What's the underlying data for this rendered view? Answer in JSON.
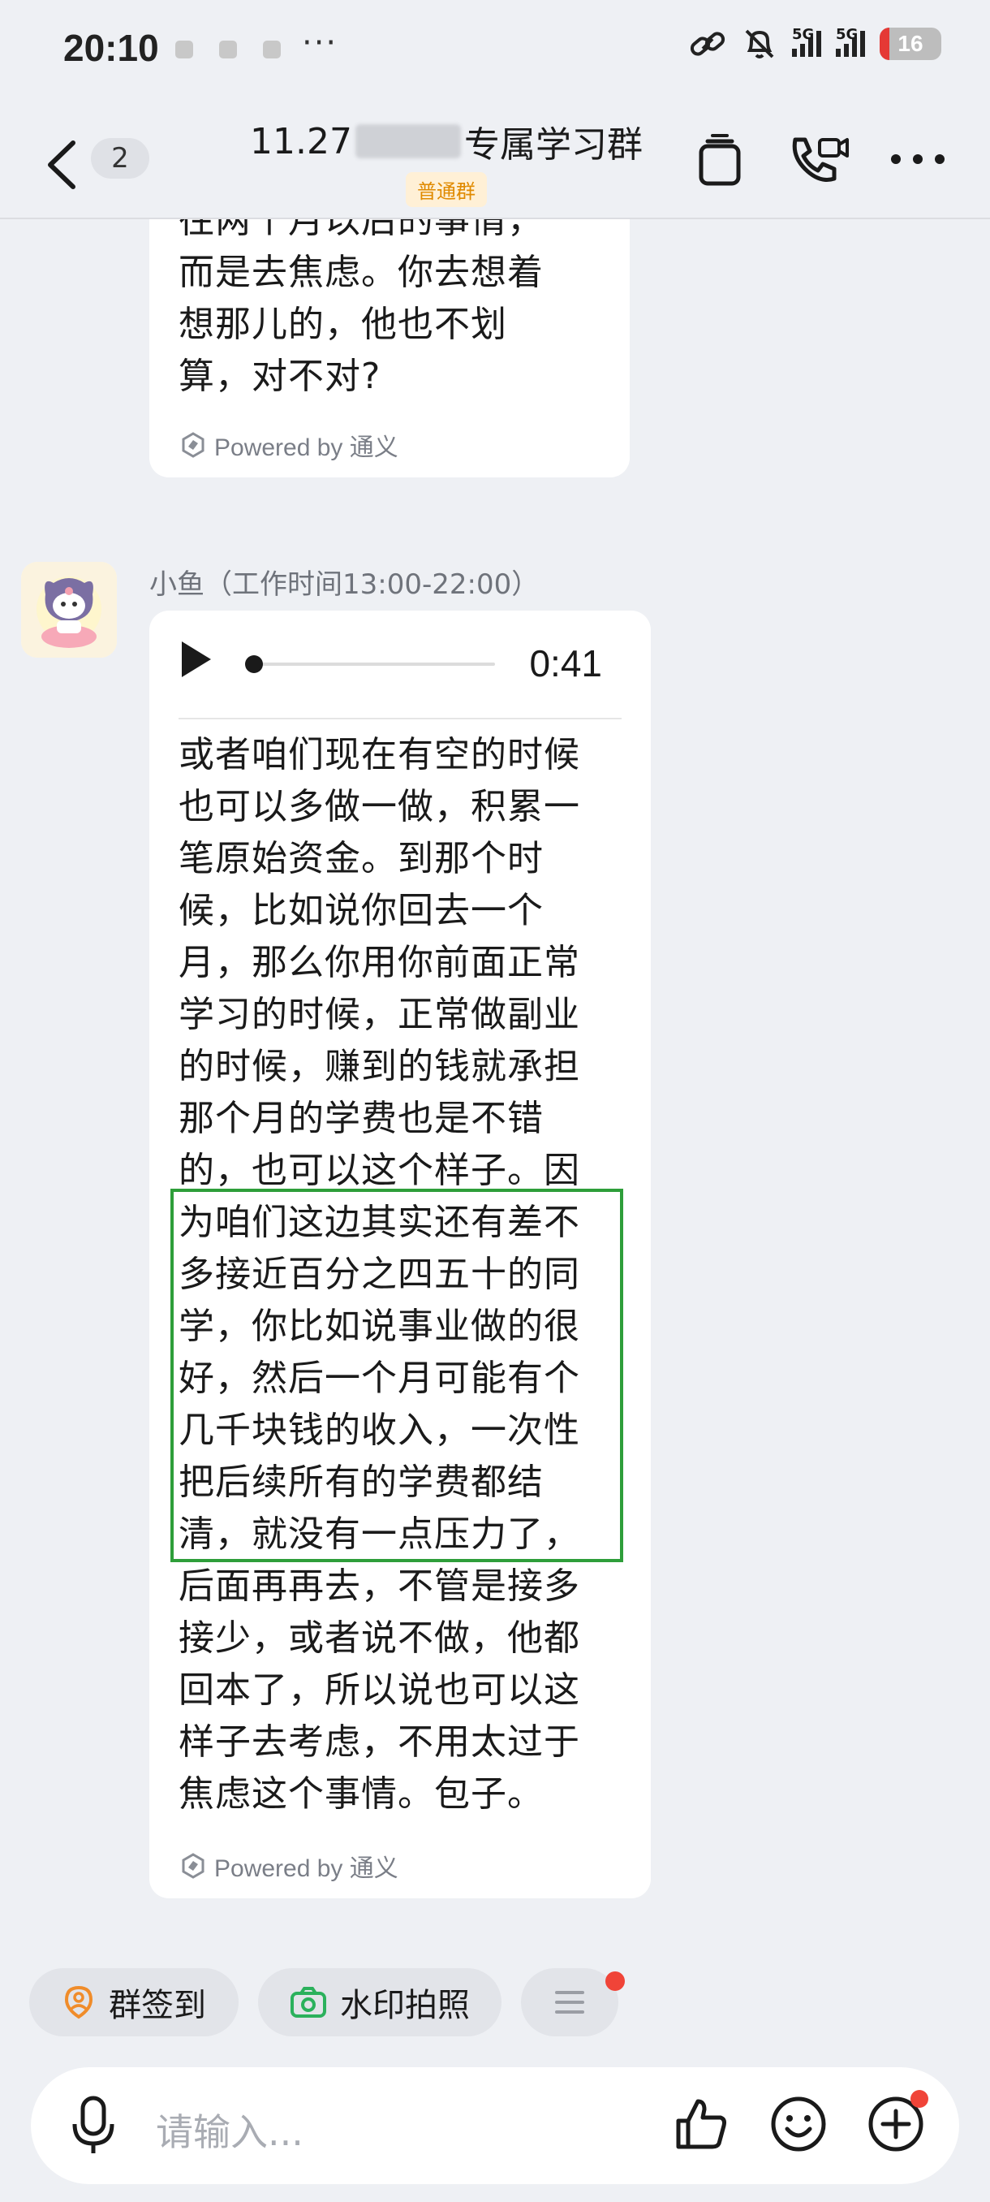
{
  "status_bar": {
    "time": "20:10",
    "more_dots": "···",
    "signal_label_1": "5G",
    "signal_label_2": "5G",
    "battery_level": 16,
    "battery_text": "16"
  },
  "header": {
    "unread_count": "2",
    "title_prefix": "11.27",
    "title_suffix": "专属学习群",
    "group_tag": "普通群"
  },
  "messages": [
    {
      "type": "text",
      "text_lines": [
        "往两个月以后的事情，",
        "而是去焦虑。你去想着",
        "想那儿的，他也不划",
        "算，对不对?"
      ],
      "powered_by": "Powered by 通义"
    },
    {
      "type": "voice",
      "sender": "小鱼（工作时间13:00-22:00）",
      "audio_duration": "0:41",
      "audio_progress": 0.0,
      "text_lines": [
        "或者咱们现在有空的时候",
        "也可以多做一做，积累一",
        "笔原始资金。到那个时",
        "候，比如说你回去一个",
        "月，那么你用你前面正常",
        "学习的时候，正常做副业",
        "的时候，赚到的钱就承担",
        "那个月的学费也是不错",
        "的，也可以这个样子。因",
        "为咱们这边其实还有差不",
        "多接近百分之四五十的同",
        "学，你比如说事业做的很",
        "好，然后一个月可能有个",
        "几千块钱的收入，一次性",
        "把后续所有的学费都结",
        "清，就没有一点压力了，",
        "后面再再去，不管是接多",
        "接少，或者说不做，他都",
        "回本了，所以说也可以这",
        "样子去考虑，不用太过于",
        "焦虑这个事情。包子。"
      ],
      "powered_by": "Powered by 通义"
    }
  ],
  "quick_actions": [
    {
      "label": "群签到",
      "icon": "location-person-icon"
    },
    {
      "label": "水印拍照",
      "icon": "camera-icon"
    },
    {
      "label": "",
      "icon": "menu-icon"
    }
  ],
  "input": {
    "placeholder": "请输入..."
  },
  "colors": {
    "background": "#eef0f4",
    "bubble": "#ffffff",
    "highlight_border": "#2e9e3a",
    "tag_text": "#e08a00",
    "badge_red": "#f04438"
  }
}
